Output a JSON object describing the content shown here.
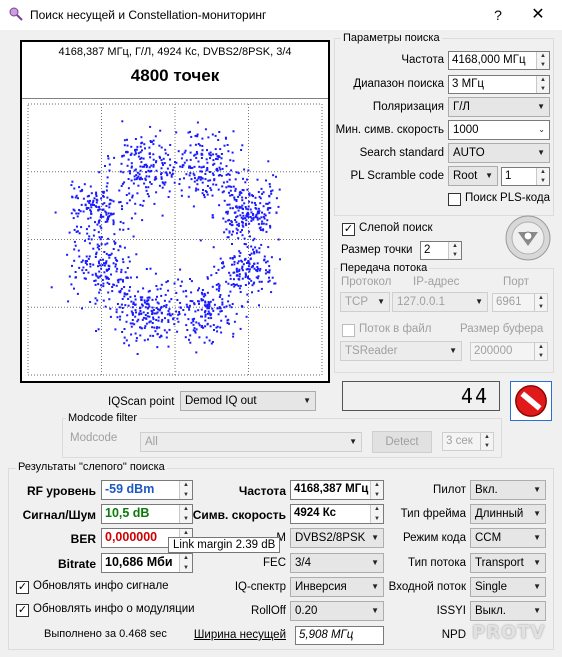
{
  "window": {
    "title": "Поиск несущей и Constellation-мониторинг",
    "help": "?",
    "close": "✕"
  },
  "constellation": {
    "header": "4168,387 МГц, Г/Л, 4924 Кс, DVBS2/8PSK, 3/4",
    "points_title": "4800 точек",
    "point_count": 4800,
    "dot_color": "#1a1aff"
  },
  "search_params": {
    "group_title": "Параметры поиска",
    "frequency_label": "Частота",
    "frequency_value": "4168,000 МГц",
    "range_label": "Диапазон поиска",
    "range_value": "3 МГц",
    "polarization_label": "Поляризация",
    "polarization_value": "Г/Л",
    "min_symrate_label": "Мин. симв. скорость",
    "min_symrate_value": "1000",
    "standard_label": "Search standard",
    "standard_value": "AUTO",
    "pl_scramble_label": "PL Scramble code",
    "pl_scramble_value": "Root",
    "pl_scramble_num": "1",
    "pls_search_label": "Поиск PLS-кода"
  },
  "blind": {
    "blind_search_label": "Слепой поиск",
    "point_size_label": "Размер точки",
    "point_size_value": "2"
  },
  "stream": {
    "group_title": "Передача потока",
    "protocol_label": "Протокол",
    "ip_label": "IP-адрес",
    "port_label": "Порт",
    "protocol_value": "TCP",
    "ip_value": "127.0.0.1",
    "port_value": "6961",
    "to_file_label": "Поток в файл",
    "buffer_label": "Размер буфера",
    "file_format": "TSReader",
    "buffer_value": "200000"
  },
  "counter": "44",
  "iqscan": {
    "label": "IQScan point",
    "value": "Demod IQ out"
  },
  "modcode": {
    "group_title": "Modcode filter",
    "label": "Modcode",
    "value": "All",
    "detect": "Detect",
    "time": "3 сек"
  },
  "results": {
    "group_title": "Результаты \"слепого\" поиска",
    "rf_label": "RF уровень",
    "rf_value": "-59 dBm",
    "snr_label": "Сигнал/Шум",
    "snr_value": "10,5 dB",
    "ber_label": "BER",
    "ber_value": "0,000000",
    "bitrate_label": "Bitrate",
    "bitrate_value": "10,686 Мби",
    "freq_label": "Частота",
    "freq_value": "4168,387 МГц",
    "symrate_label": "Симв. скорость",
    "symrate_value": "4924 Кс",
    "mod_label": "М",
    "mod_value": "DVBS2/8PSK",
    "fec_label": "FEC",
    "fec_value": "3/4",
    "iq_label": "IQ-спектр",
    "iq_value": "Инверсия",
    "rolloff_label": "RollOff",
    "rolloff_value": "0.20",
    "bandwidth_label": "Ширина несущей",
    "bandwidth_value": "5,908 МГц",
    "pilot_label": "Пилот",
    "pilot_value": "Вкл.",
    "frame_label": "Тип фрейма",
    "frame_value": "Длинный",
    "codemode_label": "Режим кода",
    "codemode_value": "CCM",
    "streamtype_label": "Тип потока",
    "streamtype_value": "Transport",
    "input_label": "Входной поток",
    "input_value": "Single",
    "issyi_label": "ISSYI",
    "issyi_value": "Выкл.",
    "npd_label": "NPD",
    "update_signal_label": "Обновлять инфо сигнале",
    "update_mod_label": "Обновлять инфо о модуляции",
    "done_text": "Выполнено за 0.468 sec"
  },
  "tooltip": "Link margin 2.39 dB",
  "watermark": "PROTV"
}
